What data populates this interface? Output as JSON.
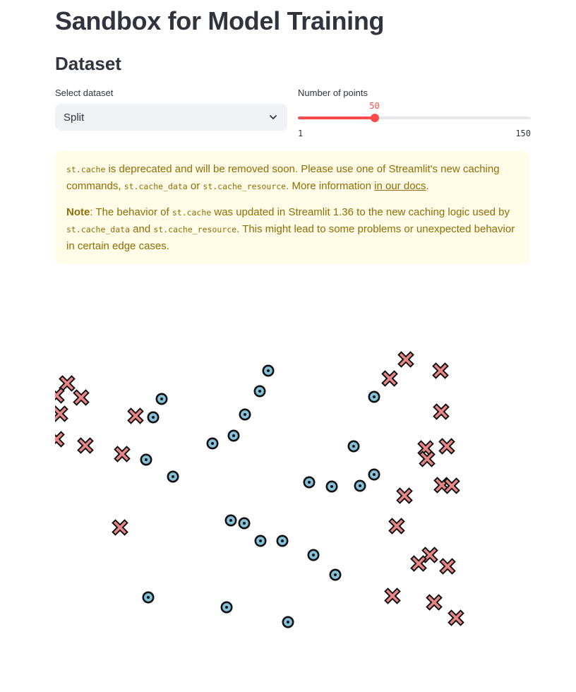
{
  "app": {
    "title": "Sandbox for Model Training"
  },
  "dataset_section": {
    "title": "Dataset",
    "select": {
      "label": "Select dataset",
      "value": "Split",
      "icon": "chevron-down-icon"
    },
    "slider": {
      "label": "Number of points",
      "min": 1,
      "max": 150,
      "value": 50,
      "min_text": "1",
      "max_text": "150",
      "value_text": "50",
      "accent_color": "#ff4b4b"
    }
  },
  "warning": {
    "p1_part1": "st.cache",
    "p1_part2": " is deprecated and will be removed soon. Please use one of Streamlit's new caching commands, ",
    "p1_part3": "st.cache_data",
    "p1_part4": " or ",
    "p1_part5": "st.cache_resource",
    "p1_part6": ". More information ",
    "p1_link": "in our docs",
    "p1_part7": ".",
    "p2_bold": "Note",
    "p2_part1": ": The behavior of ",
    "p2_part2": "st.cache",
    "p2_part3": " was updated in Streamlit 1.36 to the new caching logic used by ",
    "p2_part4": "st.cache_data",
    "p2_part5": " and ",
    "p2_part6": "st.cache_resource",
    "p2_part7": ". This might lead to some problems or unexpected behavior in certain edge cases.",
    "background_color": "#fffce7",
    "text_color": "#926c05"
  },
  "chart_data": {
    "type": "scatter",
    "title": "",
    "xlabel": "",
    "ylabel": "",
    "xlim": [
      0,
      672
    ],
    "ylim": [
      0,
      560
    ],
    "grid": false,
    "series": [
      {
        "marker": "circle",
        "color": "#85c1d8",
        "points": [
          [
            302,
            133
          ],
          [
            290,
            162
          ],
          [
            269,
            195
          ],
          [
            253,
            225
          ],
          [
            223,
            236
          ],
          [
            151,
            173
          ],
          [
            139,
            199
          ],
          [
            129,
            259
          ],
          [
            167,
            283
          ],
          [
            249,
            345
          ],
          [
            268,
            349
          ],
          [
            291,
            374
          ],
          [
            322,
            374
          ],
          [
            366,
            394
          ],
          [
            397,
            422
          ],
          [
            360,
            291
          ],
          [
            392,
            297
          ],
          [
            432,
            296
          ],
          [
            452,
            280
          ],
          [
            423,
            240
          ],
          [
            452,
            170
          ],
          [
            132,
            454
          ],
          [
            243,
            468
          ],
          [
            330,
            489
          ]
        ]
      },
      {
        "marker": "x",
        "color": "#e98686",
        "points": [
          [
            17,
            151
          ],
          [
            2,
            168
          ],
          [
            37,
            171
          ],
          [
            7,
            194
          ],
          [
            2,
            230
          ],
          [
            43,
            239
          ],
          [
            114,
            197
          ],
          [
            95,
            251
          ],
          [
            92,
            355
          ],
          [
            497,
            117
          ],
          [
            546,
            133
          ],
          [
            474,
            144
          ],
          [
            547,
            191
          ],
          [
            525,
            243
          ],
          [
            555,
            240
          ],
          [
            527,
            258
          ],
          [
            548,
            295
          ],
          [
            562,
            296
          ],
          [
            495,
            310
          ],
          [
            484,
            353
          ],
          [
            531,
            394
          ],
          [
            515,
            406
          ],
          [
            556,
            410
          ],
          [
            478,
            452
          ],
          [
            537,
            461
          ],
          [
            568,
            483
          ]
        ]
      }
    ]
  }
}
